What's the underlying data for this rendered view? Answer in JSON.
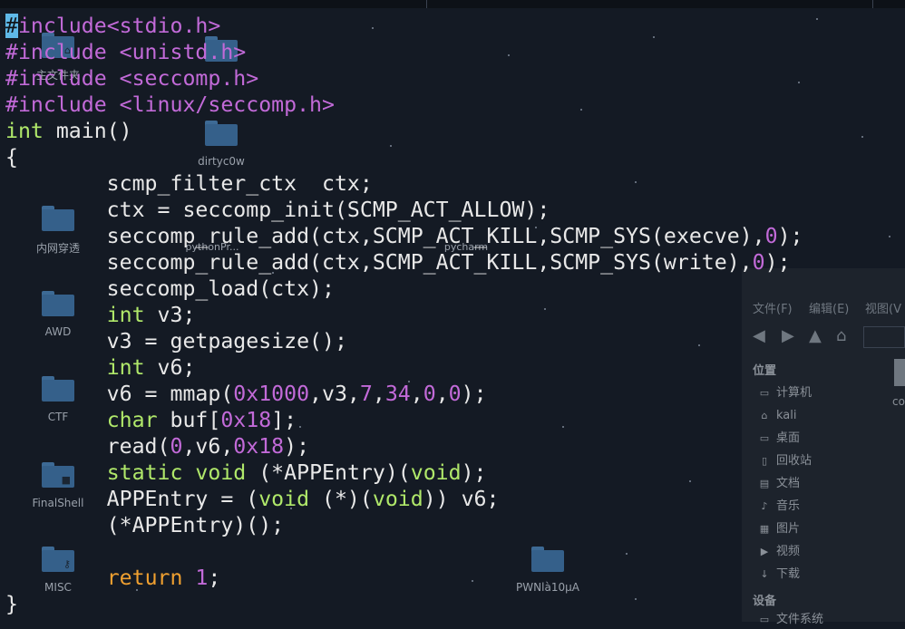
{
  "desktop_icons": [
    {
      "label": "主文件夹",
      "emblem": "home-emblem"
    },
    {
      "label": "dirtyc0w",
      "emblem": ""
    },
    {
      "label": "内网穿透",
      "emblem": ""
    },
    {
      "label": "pythonPr...",
      "emblem": ""
    },
    {
      "label": "pycharm",
      "emblem": ""
    },
    {
      "label": "AWD",
      "emblem": ""
    },
    {
      "label": "CTF",
      "emblem": ""
    },
    {
      "label": "FinalShell",
      "emblem": "lock-emblem"
    },
    {
      "label": "MISC",
      "emblem": "key-emblem"
    },
    {
      "label": "PWNlà10µA",
      "emblem": ""
    }
  ],
  "file_manager": {
    "menu": [
      "文件(F)",
      "编辑(E)",
      "视图(V"
    ],
    "partial_item_label": "co",
    "places_header": "位置",
    "places": [
      {
        "label": "计算机",
        "icon": "computer-icon"
      },
      {
        "label": "kali",
        "icon": "home-icon"
      },
      {
        "label": "桌面",
        "icon": "desktop-icon"
      },
      {
        "label": "回收站",
        "icon": "trash-icon"
      },
      {
        "label": "文档",
        "icon": "documents-icon"
      },
      {
        "label": "音乐",
        "icon": "music-icon"
      },
      {
        "label": "图片",
        "icon": "pictures-icon"
      },
      {
        "label": "视频",
        "icon": "videos-icon"
      },
      {
        "label": "下载",
        "icon": "downloads-icon"
      }
    ],
    "devices_header": "设备",
    "devices": [
      {
        "label": "文件系统",
        "icon": "drive-icon"
      }
    ]
  },
  "editor": {
    "lines": [
      [
        {
          "t": "#",
          "c": "cursor"
        },
        {
          "t": "include",
          "c": "pp"
        },
        {
          "t": "<stdio.h>",
          "c": "pp"
        }
      ],
      [
        {
          "t": "#include ",
          "c": "pp"
        },
        {
          "t": "<unistd.h>",
          "c": "pp"
        }
      ],
      [
        {
          "t": "#include ",
          "c": "pp"
        },
        {
          "t": "<seccomp.h>",
          "c": "pp"
        }
      ],
      [
        {
          "t": "#include ",
          "c": "pp"
        },
        {
          "t": "<linux/seccomp.h>",
          "c": "pp"
        }
      ],
      [
        {
          "t": "int",
          "c": "kw"
        },
        {
          "t": " main()",
          "c": ""
        }
      ],
      [
        {
          "t": "{",
          "c": ""
        }
      ],
      [
        {
          "t": "        scmp_filter_ctx  ctx;",
          "c": ""
        }
      ],
      [
        {
          "t": "        ctx = seccomp_init(SCMP_ACT_ALLOW);",
          "c": ""
        }
      ],
      [
        {
          "t": "        seccomp_rule_add(ctx,SCMP_ACT_KILL,SCMP_SYS(execve),",
          "c": ""
        },
        {
          "t": "0",
          "c": "pp"
        },
        {
          "t": ");",
          "c": ""
        }
      ],
      [
        {
          "t": "        seccomp_rule_add(ctx,SCMP_ACT_KILL,SCMP_SYS(write),",
          "c": ""
        },
        {
          "t": "0",
          "c": "pp"
        },
        {
          "t": ");",
          "c": ""
        }
      ],
      [
        {
          "t": "        seccomp_load(ctx);",
          "c": ""
        }
      ],
      [
        {
          "t": "        ",
          "c": ""
        },
        {
          "t": "int",
          "c": "kw"
        },
        {
          "t": " v3;",
          "c": ""
        }
      ],
      [
        {
          "t": "        v3 = getpagesize();",
          "c": ""
        }
      ],
      [
        {
          "t": "        ",
          "c": ""
        },
        {
          "t": "int",
          "c": "kw"
        },
        {
          "t": " v6;",
          "c": ""
        }
      ],
      [
        {
          "t": "        v6 = mmap(",
          "c": ""
        },
        {
          "t": "0x1000",
          "c": "pp"
        },
        {
          "t": ",v3,",
          "c": ""
        },
        {
          "t": "7",
          "c": "pp"
        },
        {
          "t": ",",
          "c": ""
        },
        {
          "t": "34",
          "c": "pp"
        },
        {
          "t": ",",
          "c": ""
        },
        {
          "t": "0",
          "c": "pp"
        },
        {
          "t": ",",
          "c": ""
        },
        {
          "t": "0",
          "c": "pp"
        },
        {
          "t": ");",
          "c": ""
        }
      ],
      [
        {
          "t": "        ",
          "c": ""
        },
        {
          "t": "char",
          "c": "kw"
        },
        {
          "t": " buf[",
          "c": ""
        },
        {
          "t": "0x18",
          "c": "pp"
        },
        {
          "t": "];",
          "c": ""
        }
      ],
      [
        {
          "t": "        read(",
          "c": ""
        },
        {
          "t": "0",
          "c": "pp"
        },
        {
          "t": ",v6,",
          "c": ""
        },
        {
          "t": "0x18",
          "c": "pp"
        },
        {
          "t": ");",
          "c": ""
        }
      ],
      [
        {
          "t": "        ",
          "c": ""
        },
        {
          "t": "static",
          "c": "kw"
        },
        {
          "t": " ",
          "c": ""
        },
        {
          "t": "void",
          "c": "kw"
        },
        {
          "t": " (*APPEntry)(",
          "c": ""
        },
        {
          "t": "void",
          "c": "kw"
        },
        {
          "t": ");",
          "c": ""
        }
      ],
      [
        {
          "t": "        APPEntry = (",
          "c": ""
        },
        {
          "t": "void",
          "c": "kw"
        },
        {
          "t": " (*)(",
          "c": ""
        },
        {
          "t": "void",
          "c": "kw"
        },
        {
          "t": ")) v6;",
          "c": ""
        }
      ],
      [
        {
          "t": "        (*APPEntry)();",
          "c": ""
        }
      ],
      [
        {
          "t": "",
          "c": ""
        }
      ],
      [
        {
          "t": "        ",
          "c": ""
        },
        {
          "t": "return",
          "c": "or"
        },
        {
          "t": " ",
          "c": ""
        },
        {
          "t": "1",
          "c": "pp"
        },
        {
          "t": ";",
          "c": ""
        }
      ],
      [
        {
          "t": "}",
          "c": ""
        }
      ]
    ]
  }
}
